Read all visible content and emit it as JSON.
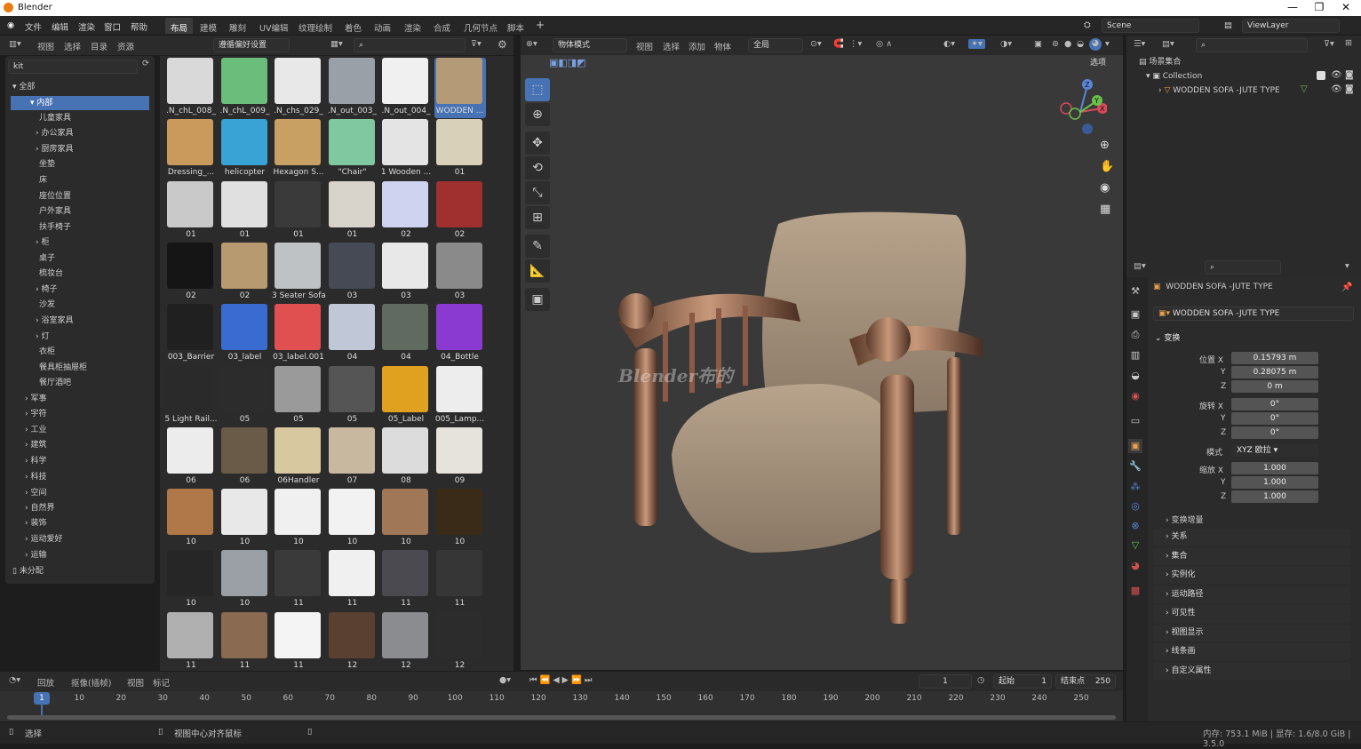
{
  "window": {
    "title": "Blender"
  },
  "menu": [
    "文件",
    "编辑",
    "渲染",
    "窗口",
    "帮助"
  ],
  "workspaces": [
    "布局",
    "建模",
    "雕刻",
    "UV编辑",
    "纹理绘制",
    "着色",
    "动画",
    "渲染",
    "合成",
    "几何节点",
    "脚本"
  ],
  "active_workspace": "布局",
  "scene": {
    "name": "Scene",
    "view_layer": "ViewLayer"
  },
  "asset_browser": {
    "menus": [
      "视图",
      "选择",
      "目录",
      "资源"
    ],
    "library": "遵循偏好设置",
    "search_value": "kit",
    "tree": [
      {
        "label": "全部",
        "level": 0,
        "expanded": true
      },
      {
        "label": "内部",
        "level": 1,
        "expanded": true,
        "selected": true
      },
      {
        "label": "儿童家具",
        "level": 2
      },
      {
        "label": "办公家具",
        "level": 2,
        "arrow": true
      },
      {
        "label": "厨房家具",
        "level": 2,
        "arrow": true
      },
      {
        "label": "坐垫",
        "level": 2
      },
      {
        "label": "床",
        "level": 2
      },
      {
        "label": "座位位置",
        "level": 2
      },
      {
        "label": "户外家具",
        "level": 2
      },
      {
        "label": "扶手椅子",
        "level": 2
      },
      {
        "label": "柜",
        "level": 2,
        "arrow": true
      },
      {
        "label": "桌子",
        "level": 2
      },
      {
        "label": "梳妆台",
        "level": 2
      },
      {
        "label": "椅子",
        "level": 2,
        "arrow": true
      },
      {
        "label": "沙发",
        "level": 2
      },
      {
        "label": "浴室家具",
        "level": 2,
        "arrow": true
      },
      {
        "label": "灯",
        "level": 2,
        "arrow": true
      },
      {
        "label": "衣柜",
        "level": 2
      },
      {
        "label": "餐具柜抽屉柜",
        "level": 2
      },
      {
        "label": "餐厅酒吧",
        "level": 2
      },
      {
        "label": "军事",
        "level": 1,
        "arrow": true
      },
      {
        "label": "宇符",
        "level": 1,
        "arrow": true
      },
      {
        "label": "工业",
        "level": 1,
        "arrow": true
      },
      {
        "label": "建筑",
        "level": 1,
        "arrow": true
      },
      {
        "label": "科学",
        "level": 1,
        "arrow": true
      },
      {
        "label": "科技",
        "level": 1,
        "arrow": true
      },
      {
        "label": "空间",
        "level": 1,
        "arrow": true
      },
      {
        "label": "自然界",
        "level": 1,
        "arrow": true
      },
      {
        "label": "装饰",
        "level": 1,
        "arrow": true
      },
      {
        "label": "运动爱好",
        "level": 1,
        "arrow": true
      },
      {
        "label": "运输",
        "level": 1,
        "arrow": true
      },
      {
        "label": "未分配",
        "level": 0
      }
    ],
    "assets": [
      {
        "label": ".N_chL_008_",
        "color": "#d9d9d9"
      },
      {
        "label": ".N_chL_009_",
        "color": "#6bbd7b"
      },
      {
        "label": ".N_chs_029_",
        "color": "#e8e8e8"
      },
      {
        "label": ".N_out_003_",
        "color": "#9aa0a8"
      },
      {
        "label": ".N_out_004_",
        "color": "#f0f0f0"
      },
      {
        "label": "WODDEN ...",
        "color": "#b59a78",
        "selected": true
      },
      {
        "label": "Dressing_...",
        "color": "#c99a5b"
      },
      {
        "label": "helicopter",
        "color": "#3aa3d6"
      },
      {
        "label": "Hexagon S...",
        "color": "#c8a064"
      },
      {
        "label": "\"Chair\"",
        "color": "#7fc8a0"
      },
      {
        "label": "1 Wooden ...",
        "color": "#e4e4e4"
      },
      {
        "label": "01",
        "color": "#d8d0b8"
      },
      {
        "label": "01",
        "color": "#c9c9c9"
      },
      {
        "label": "01",
        "color": "#e0e0e0"
      },
      {
        "label": "01",
        "color": "#3a3a3a"
      },
      {
        "label": "01",
        "color": "#d8d4cc"
      },
      {
        "label": "02",
        "color": "#cfd3f0"
      },
      {
        "label": "02",
        "color": "#a03030"
      },
      {
        "label": "02",
        "color": "#151515"
      },
      {
        "label": "02",
        "color": "#b89a70"
      },
      {
        "label": "3 Seater Sofa",
        "color": "#bfc2c4"
      },
      {
        "label": "03",
        "color": "#454a55"
      },
      {
        "label": "03",
        "color": "#e8e8e8"
      },
      {
        "label": "03",
        "color": "#8a8a8a"
      },
      {
        "label": "003_Barrier",
        "color": "#202020"
      },
      {
        "label": "03_label",
        "color": "#3a6bd0"
      },
      {
        "label": "03_label.001",
        "color": "#e05050"
      },
      {
        "label": "04",
        "color": "#c0c8d8"
      },
      {
        "label": "04",
        "color": "#606a60"
      },
      {
        "label": "04_Bottle",
        "color": "#8a3ad0"
      },
      {
        "label": "5 Light Rail...",
        "color": "#2a2a2a"
      },
      {
        "label": "05",
        "color": "#2c2c2c"
      },
      {
        "label": "05",
        "color": "#9a9a9a"
      },
      {
        "label": "05",
        "color": "#555555"
      },
      {
        "label": "05_Label",
        "color": "#e0a020"
      },
      {
        "label": "005_Lamp...",
        "color": "#ededed"
      },
      {
        "label": "06",
        "color": "#ececec"
      },
      {
        "label": "06",
        "color": "#6a5a48"
      },
      {
        "label": "06Handler",
        "color": "#d8c8a0"
      },
      {
        "label": "07",
        "color": "#c8b8a0"
      },
      {
        "label": "08",
        "color": "#dcdcdc"
      },
      {
        "label": "09",
        "color": "#e6e2dc"
      },
      {
        "label": "10",
        "color": "#b07848"
      },
      {
        "label": "10",
        "color": "#e8e8e8"
      },
      {
        "label": "10",
        "color": "#f0f0f0"
      },
      {
        "label": "10",
        "color": "#f2f2f2"
      },
      {
        "label": "10",
        "color": "#a07858"
      },
      {
        "label": "10",
        "color": "#3a2a18"
      },
      {
        "label": "10",
        "color": "#262626"
      },
      {
        "label": "10",
        "color": "#9aa0a6"
      },
      {
        "label": "11",
        "color": "#3a3a3a"
      },
      {
        "label": "11",
        "color": "#f0f0f0"
      },
      {
        "label": "11",
        "color": "#4a4a50"
      },
      {
        "label": "11",
        "color": "#363636"
      },
      {
        "label": "11",
        "color": "#b0b0b0"
      },
      {
        "label": "11",
        "color": "#8a6a50"
      },
      {
        "label": "11",
        "color": "#f4f4f4"
      },
      {
        "label": "12",
        "color": "#5a4030"
      },
      {
        "label": "12",
        "color": "#8a8c90"
      },
      {
        "label": "12",
        "color": "#2c2c2c"
      }
    ]
  },
  "viewport": {
    "mode": "物体模式",
    "menus": [
      "视图",
      "选择",
      "添加",
      "物体"
    ],
    "transform_orientation": "全局",
    "options_label": "选项",
    "watermark": "Blender布的",
    "tools": [
      "select-box",
      "cursor",
      "move",
      "rotate",
      "scale",
      "transform",
      "annotate",
      "measure",
      "add-cube"
    ]
  },
  "outliner": {
    "root": "场景集合",
    "collection": "Collection",
    "object": "WODDEN SOFA -JUTE TYPE"
  },
  "properties": {
    "object_name": "WODDEN SOFA -JUTE TYPE",
    "data_name": "WODDEN SOFA -JUTE TYPE",
    "transform_label": "变换",
    "location_label": "位置 X",
    "location": [
      "0.15793 m",
      "0.28075 m",
      "0 m"
    ],
    "rotation_label": "旋转 X",
    "rotation": [
      "0°",
      "0°",
      "0°"
    ],
    "mode_label": "模式",
    "rotation_mode": "XYZ 欧拉",
    "scale_label": "缩放 X",
    "scale": [
      "1.000",
      "1.000",
      "1.000"
    ],
    "axis_y": "Y",
    "axis_z": "Z",
    "delta_transform": "变换增量",
    "sections": [
      "关系",
      "集合",
      "实例化",
      "运动路径",
      "可见性",
      "视图显示",
      "线条画",
      "自定义属性"
    ]
  },
  "timeline": {
    "menus": [
      "回放",
      "抠像(插帧)",
      "视图",
      "标记"
    ],
    "current_frame": "1",
    "start_label": "起始",
    "start": "1",
    "end_label": "结束点",
    "end": "250",
    "ticks": [
      "1",
      "10",
      "20",
      "30",
      "40",
      "50",
      "60",
      "70",
      "80",
      "90",
      "100",
      "110",
      "120",
      "130",
      "140",
      "150",
      "160",
      "170",
      "180",
      "190",
      "200",
      "210",
      "220",
      "230",
      "240",
      "250"
    ]
  },
  "statusbar": {
    "left": "选择",
    "middle": "视图中心对齐鼠标",
    "right": "内存: 753.1 MiB | 显存: 1.6/8.0 GiB | 3.5.0"
  },
  "colors": {
    "accent": "#4772b3",
    "bg": "#1d1d1d",
    "panel": "#303030",
    "viewport": "#3a3a3a"
  }
}
